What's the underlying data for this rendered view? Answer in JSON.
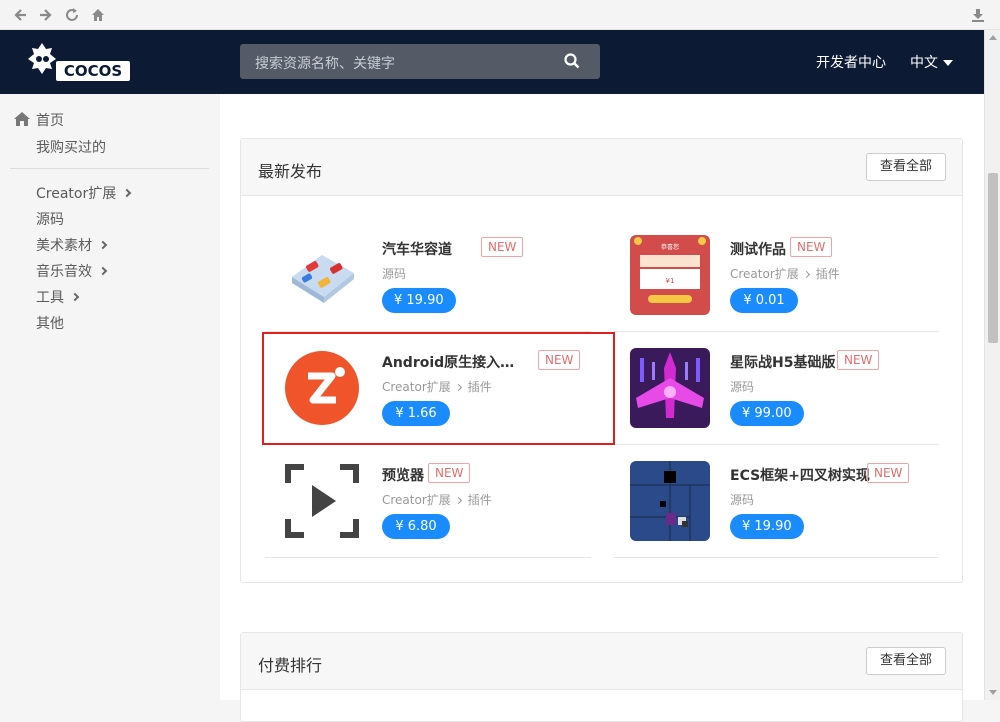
{
  "browser": {
    "icons": [
      "back-icon",
      "forward-icon",
      "reload-icon",
      "home-icon",
      "download-icon"
    ]
  },
  "header": {
    "logo_text": "COCOS",
    "search_placeholder": "搜索资源名称、关键字",
    "dev_center": "开发者中心",
    "language": "中文"
  },
  "sidebar": {
    "home": "首页",
    "purchased": "我购买过的",
    "categories": [
      {
        "label": "Creator扩展",
        "has_children": true
      },
      {
        "label": "源码",
        "has_children": false
      },
      {
        "label": "美术素材",
        "has_children": true
      },
      {
        "label": "音乐音效",
        "has_children": true
      },
      {
        "label": "工具",
        "has_children": true
      },
      {
        "label": "其他",
        "has_children": false
      }
    ]
  },
  "latest": {
    "title": "最新发布",
    "view_all": "查看全部",
    "items": [
      {
        "name": "汽车华容道",
        "badge": "NEW",
        "category": "源码",
        "subcategory": "",
        "price": "¥ 19.90"
      },
      {
        "name": "测试作品",
        "badge": "NEW",
        "category": "Creator扩展",
        "subcategory": "插件",
        "price": "¥ 0.01"
      },
      {
        "name": "Android原生接入微…",
        "badge": "NEW",
        "category": "Creator扩展",
        "subcategory": "插件",
        "price": "¥ 1.66"
      },
      {
        "name": "星际战H5基础版",
        "badge": "NEW",
        "category": "源码",
        "subcategory": "",
        "price": "¥ 99.00"
      },
      {
        "name": "预览器",
        "badge": "NEW",
        "category": "Creator扩展",
        "subcategory": "插件",
        "price": "¥ 6.80"
      },
      {
        "name": "ECS框架+四叉树实现",
        "badge": "NEW",
        "category": "源码",
        "subcategory": "",
        "price": "¥ 19.90"
      }
    ]
  },
  "paid_ranking": {
    "title": "付费排行",
    "view_all": "查看全部"
  },
  "thumb_texts": {
    "test_work_title": "恭喜您",
    "test_work_price": "¥1"
  },
  "colors": {
    "header_bg": "#0d1a33",
    "price_blue": "#1a8cff",
    "badge_red": "#e46c6c",
    "highlight": "#e02020"
  }
}
